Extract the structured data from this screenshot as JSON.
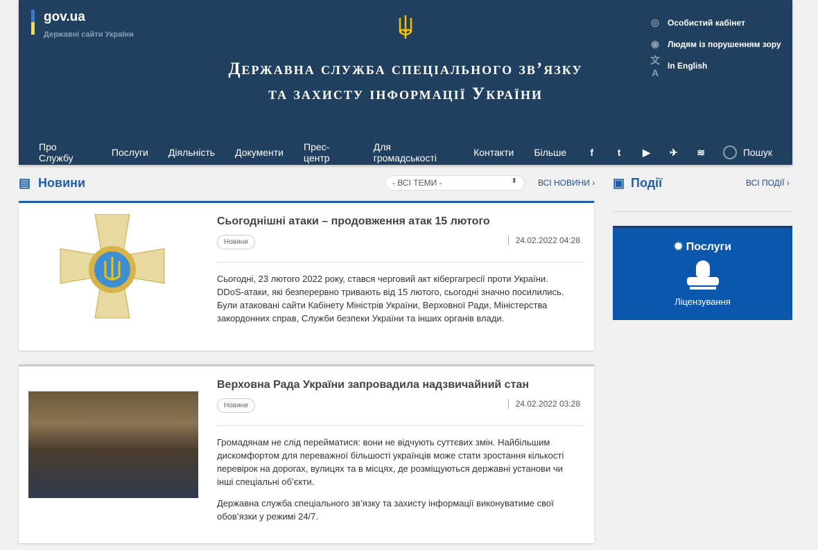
{
  "header": {
    "gov_title": "gov.ua",
    "gov_subtitle": "Державні сайти України",
    "title_line1": "Державна служба спеціального зв’язку",
    "title_line2": "та захисту інформації України",
    "top_links": [
      {
        "icon": "user-circle-icon",
        "label": "Особистий кабінет"
      },
      {
        "icon": "eye-icon",
        "label": "Людям із порушенням зору"
      },
      {
        "icon": "translate-icon",
        "label": "In English"
      }
    ],
    "nav": [
      "Про Службу",
      "Послуги",
      "Діяльність",
      "Документи",
      "Прес-центр",
      "Для громадськості",
      "Контакти",
      "Більше"
    ],
    "social": [
      "f",
      "t",
      "▶",
      "✈",
      "≋"
    ],
    "search": "Пошук"
  },
  "news": {
    "heading": "Новини",
    "filter": "- ВСІ ТЕМИ -",
    "all": "ВСІ НОВИНИ",
    "items": [
      {
        "title": "Сьогоднішні атаки – продовження атак 15 лютого",
        "tag": "Новини",
        "date": "24.02.2022 04:28",
        "paragraphs": [
          "Сьогодні, 23 лютого 2022 року, стався черговий акт кібергагресії проти України. DDoS-атаки, які безперервно тривають від 15 лютого, сьогодні значно посилились. Були атаковані сайти Кабінету Міністрів України, Верховної Ради, Міністерства закордонних справ, Служби безпеки України та інших органів влади."
        ]
      },
      {
        "title": "Верховна Рада України запровадила надзвичайний стан",
        "tag": "Новини",
        "date": "24.02.2022 03:28",
        "paragraphs": [
          "Громадянам не слід перейматися: вони не відчують суттєвих змін. Найбільшим дискомфортом для переважної більшості українців може стати зростання кількості перевірок на дорогах, вулицях та в місцях, де розміщуються державні установи чи інші спеціальні об’єкти.",
          "Державна служба спеціального зв’язку та захисту інформації виконуватиме свої обов’язки у режимі 24/7."
        ]
      }
    ]
  },
  "events": {
    "heading": "Події",
    "all": "ВСІ ПОДІЇ"
  },
  "services": {
    "heading": "Послуги",
    "item": "Ліцензування"
  }
}
